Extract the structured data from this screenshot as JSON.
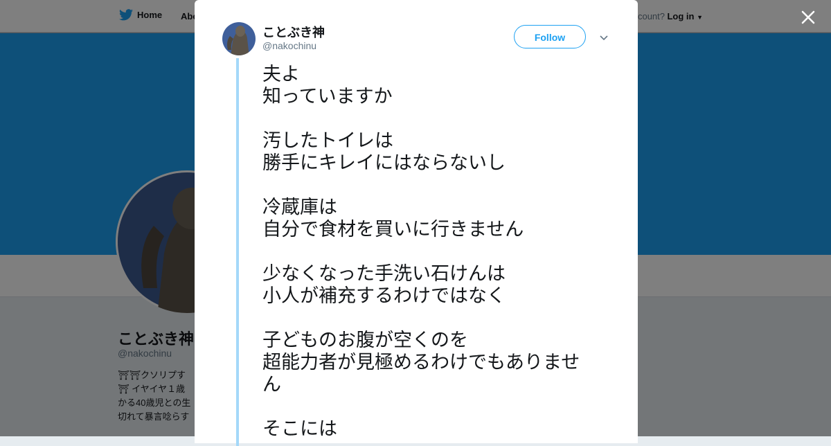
{
  "nav": {
    "home_label": "Home",
    "about_label": "Abo",
    "account_label": "account?",
    "login_label": "Log in"
  },
  "profile": {
    "name": "ことぶき神",
    "handle": "@nakochinu",
    "bio": "⛩⛩クソリプす\n⛩ イヤイヤ１歳\nかる40歳児との生\n切れて暴言唸らす"
  },
  "tweet": {
    "display_name": "ことぶき神",
    "handle": "@nakochinu",
    "follow_label": "Follow",
    "text": "夫よ\n知っていますか\n\n汚したトイレは\n勝手にキレイにはならないし\n\n冷蔵庫は\n自分で食材を買いに行きません\n\n少なくなった手洗い石けんは\n小人が補充するわけではなく\n\n子どものお腹が空くのを\n超能力者が見極めるわけでもありません\n\nそこには"
  },
  "icons": {
    "twitter_bird": "twitter-bird-icon",
    "close": "close-icon",
    "caret": "chevron-down-icon"
  },
  "colors": {
    "brand_blue": "#1da1f2",
    "thread_line": "#a4d8f9",
    "text_primary": "#14171a",
    "text_secondary": "#657786"
  }
}
